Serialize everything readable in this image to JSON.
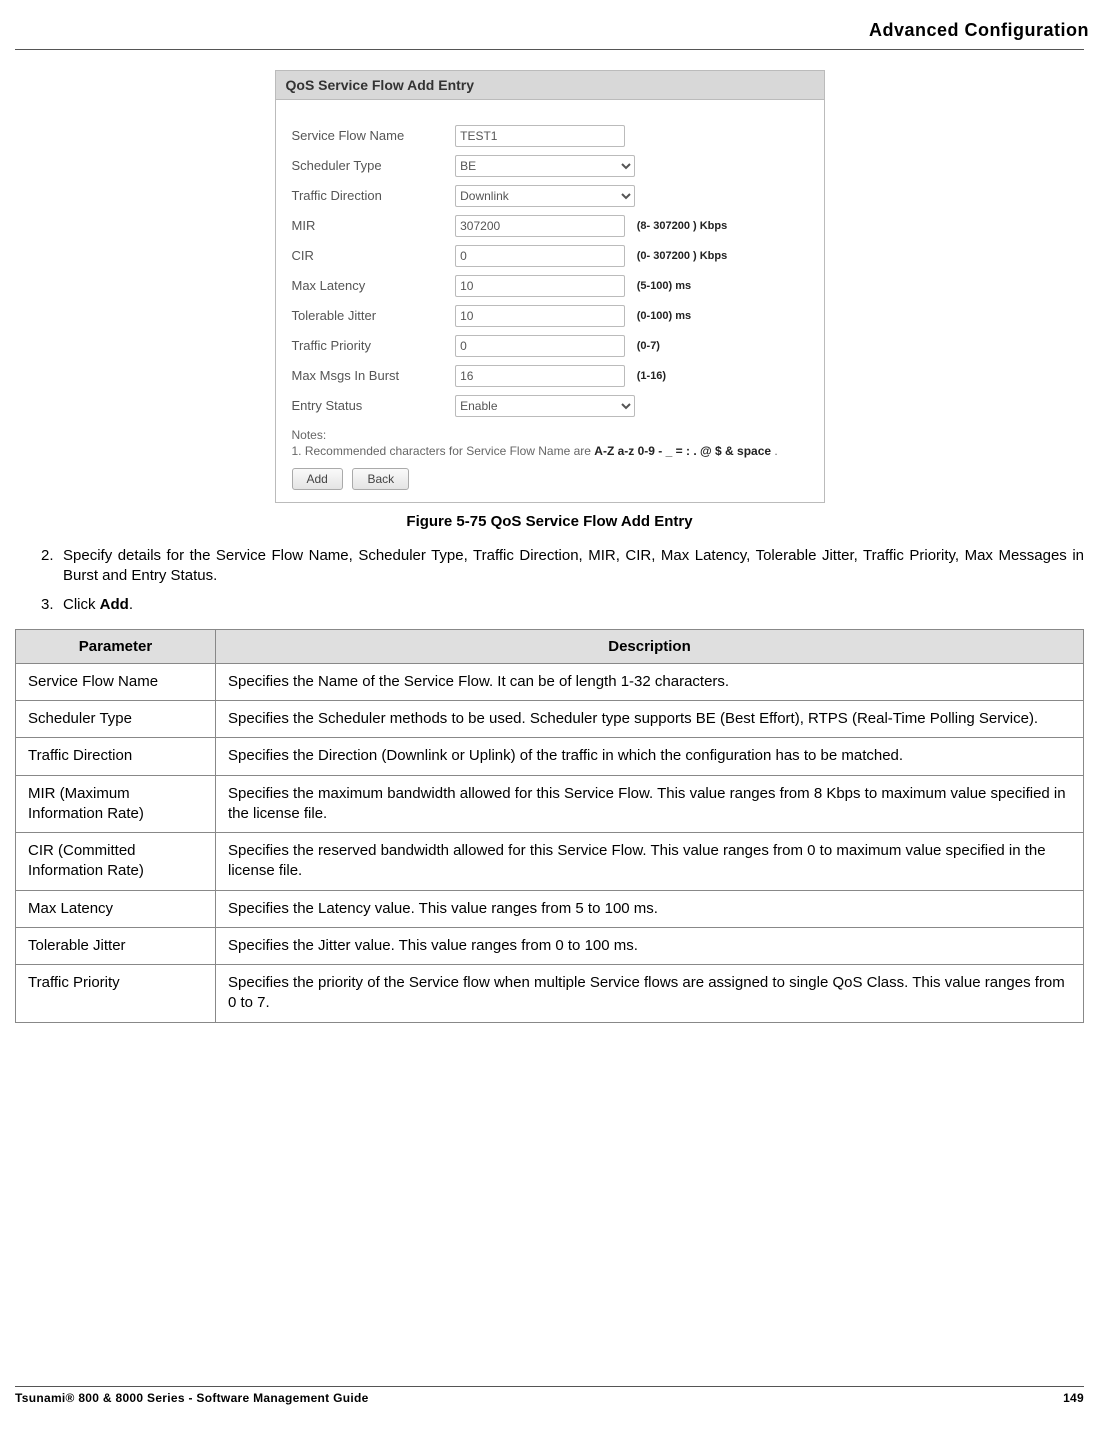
{
  "header": {
    "title": "Advanced Configuration"
  },
  "figure": {
    "panel_title": "QoS Service Flow Add Entry",
    "fields": {
      "service_flow_name": {
        "label": "Service Flow Name",
        "value": "TEST1"
      },
      "scheduler_type": {
        "label": "Scheduler Type",
        "value": "BE"
      },
      "traffic_direction": {
        "label": "Traffic Direction",
        "value": "Downlink"
      },
      "mir": {
        "label": "MIR",
        "value": "307200",
        "hint": "(8- 307200 ) Kbps"
      },
      "cir": {
        "label": "CIR",
        "value": "0",
        "hint": "(0- 307200 ) Kbps"
      },
      "max_latency": {
        "label": "Max Latency",
        "value": "10",
        "hint": "(5-100) ms"
      },
      "tolerable_jitter": {
        "label": "Tolerable Jitter",
        "value": "10",
        "hint": "(0-100) ms"
      },
      "traffic_priority": {
        "label": "Traffic Priority",
        "value": "0",
        "hint": "(0-7)"
      },
      "max_msgs_in_burst": {
        "label": "Max Msgs In Burst",
        "value": "16",
        "hint": "(1-16)"
      },
      "entry_status": {
        "label": "Entry Status",
        "value": "Enable"
      }
    },
    "notes_label": "Notes:",
    "notes_prefix": "1. Recommended characters for ",
    "notes_param": "Service Flow Name",
    "notes_mid": " are ",
    "notes_bold": "A-Z a-z 0-9 - _ = : . @ $ & space",
    "notes_suffix": " .",
    "buttons": {
      "add": "Add",
      "back": "Back"
    },
    "caption": "Figure 5-75 QoS Service Flow Add Entry"
  },
  "steps": {
    "s2_num": "2.",
    "s2_text": "Specify details for the Service Flow Name, Scheduler Type, Traffic Direction, MIR, CIR, Max Latency, Tolerable Jitter, Traffic Priority, Max Messages in Burst and Entry Status.",
    "s3_num": "3.",
    "s3_prefix": "Click ",
    "s3_bold": "Add",
    "s3_suffix": "."
  },
  "table": {
    "headers": {
      "param": "Parameter",
      "desc": "Description"
    },
    "rows": [
      {
        "param": "Service Flow Name",
        "desc": "Specifies the Name of the Service Flow. It can be of length 1-32 characters."
      },
      {
        "param": "Scheduler Type",
        "desc": "Specifies the Scheduler methods to be used. Scheduler type supports BE (Best Effort), RTPS (Real-Time Polling Service)."
      },
      {
        "param": "Traffic Direction",
        "desc": "Specifies the Direction (Downlink or Uplink) of the traffic in which the configuration has to be matched."
      },
      {
        "param": "MIR (Maximum Information Rate)",
        "desc": "Specifies the maximum bandwidth allowed for this Service Flow. This value ranges from 8 Kbps to maximum value specified in the license file."
      },
      {
        "param": "CIR (Committed Information Rate)",
        "desc": "Specifies the reserved bandwidth allowed for this Service Flow. This value ranges from 0 to maximum value specified in the license file."
      },
      {
        "param": "Max Latency",
        "desc": "Specifies the Latency value. This value ranges from 5 to 100 ms."
      },
      {
        "param": "Tolerable Jitter",
        "desc": "Specifies the Jitter value. This value ranges from 0 to 100 ms."
      },
      {
        "param": "Traffic Priority",
        "desc": "Specifies the priority of the Service flow when multiple Service flows are assigned to single QoS Class. This value ranges from 0 to 7."
      }
    ]
  },
  "footer": {
    "left": "Tsunami® 800 & 8000 Series - Software Management Guide",
    "right": "149"
  }
}
